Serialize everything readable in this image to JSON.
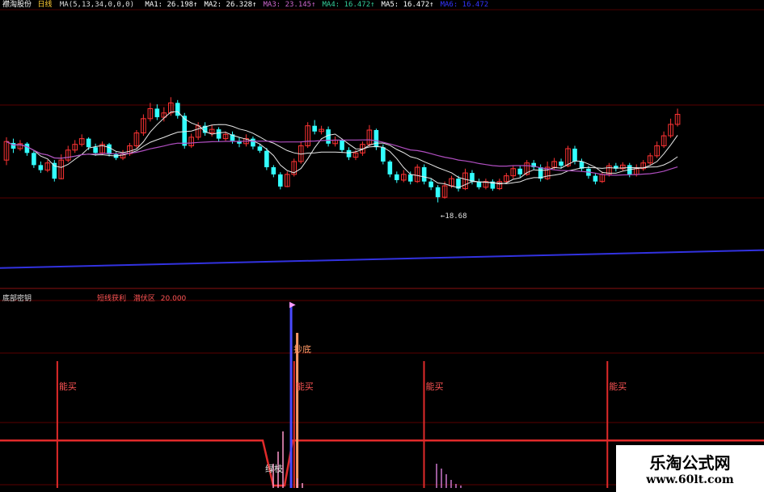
{
  "header": {
    "stock_name": "襟淘股份",
    "period": "日线",
    "ma_params": "MA(5,13,34,0,0,0)",
    "ma_values": [
      {
        "label": "MA1:",
        "value": "26.198↑",
        "color": "#ffffff"
      },
      {
        "label": "MA2:",
        "value": "26.328↑",
        "color": "#ffffff"
      },
      {
        "label": "MA3:",
        "value": "23.145↑",
        "color": "#cc66cc"
      },
      {
        "label": "MA4:",
        "value": "16.472↑",
        "color": "#33cc99"
      },
      {
        "label": "MA5:",
        "value": "16.472↑",
        "color": "#ffffff"
      },
      {
        "label": "MA6:",
        "value": "16.472",
        "color": "#3333ff"
      }
    ]
  },
  "price_panel": {
    "low_marker": "←18.68",
    "candles": [
      [
        24.6,
        27.2,
        23.9,
        27.8
      ],
      [
        27.0,
        26.2,
        25.6,
        27.6
      ],
      [
        26.2,
        26.9,
        25.9,
        27.4
      ],
      [
        26.9,
        25.6,
        25.2,
        27.1
      ],
      [
        25.6,
        23.9,
        23.5,
        25.9
      ],
      [
        23.9,
        23.2,
        22.8,
        24.4
      ],
      [
        23.2,
        24.2,
        22.9,
        24.6
      ],
      [
        24.2,
        22.0,
        21.6,
        24.6
      ],
      [
        22.0,
        24.6,
        21.9,
        25.4
      ],
      [
        24.6,
        26.0,
        24.3,
        26.6
      ],
      [
        26.0,
        26.8,
        25.6,
        27.4
      ],
      [
        26.8,
        27.6,
        26.5,
        28.2
      ],
      [
        27.6,
        26.4,
        26.0,
        27.8
      ],
      [
        26.4,
        25.6,
        25.2,
        26.9
      ],
      [
        25.6,
        26.8,
        25.4,
        27.2
      ],
      [
        26.8,
        25.4,
        25.1,
        27.0
      ],
      [
        25.4,
        24.9,
        24.6,
        25.7
      ],
      [
        24.9,
        25.5,
        24.6,
        26.0
      ],
      [
        25.5,
        26.6,
        25.2,
        27.0
      ],
      [
        26.6,
        28.4,
        26.3,
        28.8
      ],
      [
        28.4,
        30.4,
        28.0,
        31.0
      ],
      [
        30.4,
        31.8,
        30.0,
        32.6
      ],
      [
        31.8,
        30.6,
        30.2,
        32.4
      ],
      [
        30.6,
        31.2,
        30.0,
        32.0
      ],
      [
        31.2,
        32.6,
        30.8,
        33.4
      ],
      [
        32.6,
        30.8,
        30.4,
        33.0
      ],
      [
        30.8,
        26.6,
        26.2,
        31.2
      ],
      [
        26.6,
        27.8,
        26.3,
        28.3
      ],
      [
        27.8,
        29.4,
        27.4,
        29.9
      ],
      [
        29.4,
        28.4,
        28.0,
        29.9
      ],
      [
        28.4,
        28.9,
        27.9,
        29.5
      ],
      [
        28.9,
        27.6,
        27.2,
        29.2
      ],
      [
        27.6,
        28.2,
        27.3,
        28.6
      ],
      [
        28.2,
        27.3,
        26.9,
        28.6
      ],
      [
        27.3,
        26.9,
        26.4,
        27.8
      ],
      [
        26.9,
        27.6,
        26.5,
        28.2
      ],
      [
        27.6,
        26.5,
        26.1,
        27.9
      ],
      [
        26.5,
        25.9,
        25.6,
        26.9
      ],
      [
        25.9,
        23.6,
        23.2,
        26.3
      ],
      [
        23.6,
        22.6,
        22.2,
        23.9
      ],
      [
        22.6,
        20.9,
        20.5,
        22.9
      ],
      [
        20.9,
        22.6,
        20.8,
        23.0
      ],
      [
        22.6,
        24.4,
        22.3,
        24.8
      ],
      [
        24.4,
        26.6,
        24.1,
        27.2
      ],
      [
        26.6,
        29.4,
        26.3,
        29.9
      ],
      [
        29.4,
        28.6,
        28.2,
        30.2
      ],
      [
        28.6,
        28.9,
        28.2,
        29.4
      ],
      [
        28.9,
        26.9,
        26.5,
        29.3
      ],
      [
        26.9,
        27.4,
        26.5,
        27.9
      ],
      [
        27.4,
        26.0,
        25.6,
        27.6
      ],
      [
        26.0,
        25.0,
        24.6,
        26.4
      ],
      [
        25.0,
        25.6,
        24.6,
        26.0
      ],
      [
        25.6,
        26.8,
        25.2,
        27.2
      ],
      [
        26.8,
        28.8,
        26.5,
        29.5
      ],
      [
        28.8,
        26.4,
        26.0,
        29.0
      ],
      [
        26.4,
        24.4,
        24.0,
        26.8
      ],
      [
        24.4,
        22.6,
        22.2,
        24.6
      ],
      [
        22.6,
        21.8,
        21.4,
        23.0
      ],
      [
        21.8,
        22.6,
        21.5,
        23.2
      ],
      [
        22.6,
        21.6,
        21.2,
        23.0
      ],
      [
        21.6,
        23.6,
        21.4,
        24.0
      ],
      [
        23.6,
        21.6,
        21.2,
        24.0
      ],
      [
        21.6,
        20.8,
        20.4,
        22.0
      ],
      [
        20.8,
        19.4,
        18.68,
        21.1
      ],
      [
        19.4,
        21.0,
        19.2,
        21.6
      ],
      [
        21.0,
        22.0,
        20.7,
        22.4
      ],
      [
        22.0,
        20.6,
        20.2,
        22.4
      ],
      [
        20.6,
        22.8,
        20.4,
        23.4
      ],
      [
        22.8,
        21.6,
        21.2,
        23.2
      ],
      [
        21.6,
        20.8,
        20.5,
        22.0
      ],
      [
        20.8,
        21.6,
        20.5,
        22.0
      ],
      [
        21.6,
        20.6,
        20.3,
        21.9
      ],
      [
        20.6,
        21.6,
        20.4,
        22.0
      ],
      [
        21.6,
        22.4,
        21.3,
        22.8
      ],
      [
        22.4,
        23.4,
        22.0,
        23.8
      ],
      [
        23.4,
        22.6,
        22.2,
        23.8
      ],
      [
        22.6,
        24.2,
        22.4,
        24.6
      ],
      [
        24.2,
        23.6,
        23.2,
        24.6
      ],
      [
        23.6,
        22.0,
        21.6,
        24.0
      ],
      [
        22.0,
        23.6,
        21.8,
        24.4
      ],
      [
        23.6,
        24.4,
        23.3,
        24.9
      ],
      [
        24.4,
        23.8,
        23.4,
        24.8
      ],
      [
        23.8,
        26.2,
        23.6,
        26.6
      ],
      [
        26.2,
        24.4,
        24.0,
        26.6
      ],
      [
        24.4,
        23.4,
        23.0,
        24.8
      ],
      [
        23.4,
        22.4,
        22.0,
        23.8
      ],
      [
        22.4,
        21.6,
        21.2,
        22.8
      ],
      [
        21.6,
        22.6,
        21.4,
        23.0
      ],
      [
        22.6,
        23.8,
        22.3,
        24.2
      ],
      [
        23.8,
        23.4,
        23.0,
        24.2
      ],
      [
        23.4,
        23.9,
        23.1,
        24.3
      ],
      [
        23.9,
        22.6,
        22.2,
        24.2
      ],
      [
        22.6,
        23.4,
        22.3,
        24.0
      ],
      [
        23.4,
        24.2,
        23.1,
        24.6
      ],
      [
        24.2,
        25.2,
        23.9,
        25.6
      ],
      [
        25.2,
        26.6,
        24.9,
        27.2
      ],
      [
        26.6,
        28.0,
        26.3,
        28.6
      ],
      [
        28.0,
        29.6,
        27.7,
        30.4
      ],
      [
        29.6,
        31.0,
        29.3,
        31.8
      ]
    ],
    "long_ma_range": [
      9.5,
      12.0
    ]
  },
  "indicator_panel": {
    "name": "底部密钥",
    "param_label": "短线获利",
    "param_zone": "潜伏区",
    "param_value": "20.000",
    "buy_label": "能买",
    "bottom_label": "抄底",
    "low_label": "绿枝",
    "buy_positions": [
      0.075,
      0.385,
      0.555,
      0.795
    ],
    "tall_bar_position": 0.381,
    "tall_bar2_position": 0.389,
    "threshold_fraction": 0.26,
    "arrow_label": "▶"
  },
  "watermark": {
    "title": "乐淘公式网",
    "url": "www.60lt.com"
  },
  "colors": {
    "up": "#ff3333",
    "down": "#33ffff",
    "ma_white": "#e8e8e8",
    "ma_purple": "#b04ec0",
    "ma_blue": "#3232e0",
    "signal_red": "#e02a2a",
    "grid_red": "#5a0000"
  }
}
